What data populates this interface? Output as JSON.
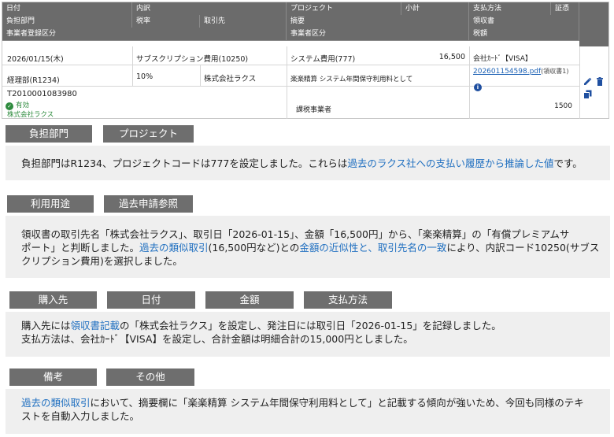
{
  "table": {
    "headers": {
      "date": "日付",
      "category": "内訳",
      "project": "プロジェクト",
      "subtotal": "小計",
      "payment": "支払方法",
      "evidence": "証憑",
      "department": "負担部門",
      "tax_rate": "税率",
      "vendor": "取引先",
      "summary": "摘要",
      "receipt": "領収書",
      "registration": "事業者登録区分",
      "business_class": "事業者区分",
      "tax_amount": "税額"
    },
    "row": {
      "date": "2026/01/15(木)",
      "category": "サブスクリプション費用(10250)",
      "project": "システム費用(777)",
      "subtotal": "16,500",
      "payment": "会社ｶｰﾄﾞ【VISA】",
      "department": "経理部(R1234)",
      "tax_rate": "10%",
      "vendor": "株式会社ラクス",
      "summary": "楽楽精算 システム年間保守利用料として",
      "receipt_file": "202601154598.pdf",
      "receipt_note": "(領収書1)",
      "registration_number": "T2010001083980",
      "registration_status": "有効",
      "registration_vendor": "株式会社ラクス",
      "business_class": "課税事業者",
      "tax_amount": "1500"
    }
  },
  "sections": [
    {
      "tags": [
        "負担部門",
        "プロジェクト"
      ],
      "lines": [
        [
          {
            "t": "負担部門はR1234、プロジェクトコードは777を設定しました。これらは",
            "hl": false
          },
          {
            "t": "過去のラクス社への支払い履歴から推論した値",
            "hl": true
          },
          {
            "t": "です。",
            "hl": false
          }
        ]
      ]
    },
    {
      "tags": [
        "利用用途",
        "過去申請参照"
      ],
      "lines": [
        [
          {
            "t": "領収書の取引先名「株式会社ラクス」、取引日「2026-01-15」、金額「16,500円」から、「楽楽精算」の「有償プレミアムサ",
            "hl": false
          }
        ],
        [
          {
            "t": "ポート」と判断しました。",
            "hl": false
          },
          {
            "t": "過去の類似取引",
            "hl": true
          },
          {
            "t": "(16,500円など)との",
            "hl": false
          },
          {
            "t": "金額の近似性と、取引先名の一致",
            "hl": true
          },
          {
            "t": "により、内訳コード10250(サブス",
            "hl": false
          }
        ],
        [
          {
            "t": "クリプション費用)を選択しました。",
            "hl": false
          }
        ]
      ]
    },
    {
      "tags": [
        "購入先",
        "日付",
        "金額",
        "支払方法"
      ],
      "lines": [
        [
          {
            "t": "購入先には",
            "hl": false
          },
          {
            "t": "領収書記載",
            "hl": true
          },
          {
            "t": "の「株式会社ラクス」を設定し、発注日には取引日「2026-01-15」を記録しました。",
            "hl": false
          }
        ],
        [
          {
            "t": "支払方法は、会社ｶｰﾄﾞ【VISA】を設定し、合計金額は明細合計の15,000円としました。",
            "hl": false
          }
        ]
      ]
    },
    {
      "tags": [
        "備考",
        "その他"
      ],
      "lines": [
        [
          {
            "t": "過去の類似取引",
            "hl": true
          },
          {
            "t": "において、摘要欄に「楽楽精算 システム年間保守利用料として」と記載する傾向が強いため、今回も同様のテキ",
            "hl": false
          }
        ],
        [
          {
            "t": "ストを自動入力しました。",
            "hl": false
          }
        ]
      ]
    }
  ],
  "icons": {
    "edit": "pencil-icon",
    "delete": "trash-icon",
    "copy": "copy-icon",
    "status_ok": "check-circle-icon",
    "info": "info-icon"
  },
  "colors": {
    "header_bg": "#6b6b6b",
    "tag_bg": "#6e6e6e",
    "panel_bg": "#efefef",
    "highlight": "#1f6fc0",
    "link": "#1f63b5",
    "ok": "#2e8b3e",
    "icon": "#1f4fa0"
  }
}
